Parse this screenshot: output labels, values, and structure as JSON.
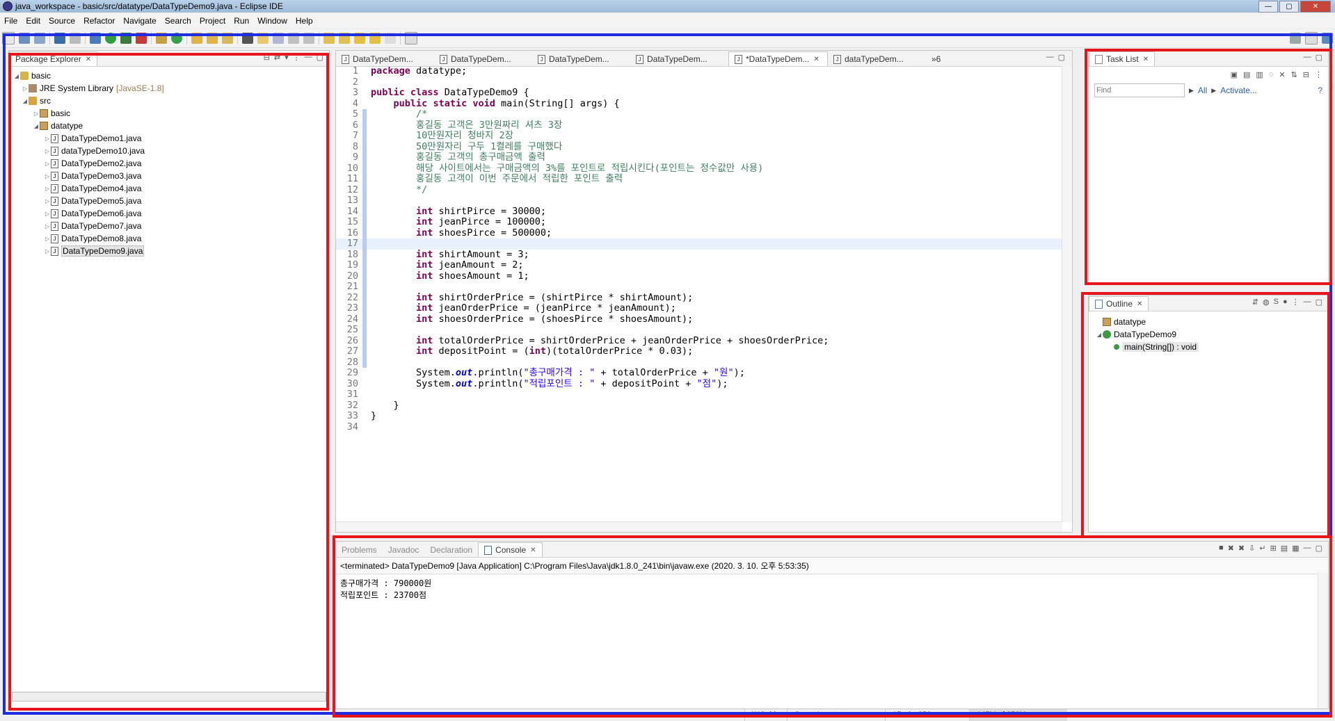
{
  "window": {
    "title": "java_workspace - basic/src/datatype/DataTypeDemo9.java - Eclipse IDE"
  },
  "menu": [
    "File",
    "Edit",
    "Source",
    "Refactor",
    "Navigate",
    "Search",
    "Project",
    "Run",
    "Window",
    "Help"
  ],
  "package_explorer": {
    "title": "Package Explorer",
    "project": "basic",
    "library": "JRE System Library",
    "library_version": "[JavaSE-1.8]",
    "src": "src",
    "packages": [
      "basic",
      "datatype"
    ],
    "files": [
      "DataTypeDemo1.java",
      "dataTypeDemo10.java",
      "DataTypeDemo2.java",
      "DataTypeDemo3.java",
      "DataTypeDemo4.java",
      "DataTypeDemo5.java",
      "DataTypeDemo6.java",
      "DataTypeDemo7.java",
      "DataTypeDemo8.java",
      "DataTypeDemo9.java"
    ]
  },
  "editor": {
    "tabs": [
      "DataTypeDem...",
      "DataTypeDem...",
      "DataTypeDem...",
      "DataTypeDem...",
      "*DataTypeDem...",
      "dataTypeDem..."
    ],
    "overflow": "»6",
    "lines": [
      "package datatype;",
      "",
      "public class DataTypeDemo9 {",
      "    public static void main(String[] args) {",
      "        /*",
      "        홍길동 고객은 3만원짜리 셔츠 3장",
      "        10만원자리 청바지 2장",
      "        50만원자리 구두 1켤레를 구매했다",
      "        홍길동 고객의 총구매금액 출력",
      "        해당 사이트에서는 구매금액의 3%를 포인트로 적립시킨다(포인트는 정수값만 사용)",
      "        홍길동 고객이 이번 주문에서 적립한 포인트 출력",
      "        */",
      "",
      "        int shirtPirce = 30000;",
      "        int jeanPirce = 100000;",
      "        int shoesPirce = 500000;",
      "",
      "        int shirtAmount = 3;",
      "        int jeanAmount = 2;",
      "        int shoesAmount = 1;",
      "",
      "        int shirtOrderPrice = (shirtPirce * shirtAmount);",
      "        int jeanOrderPrice = (jeanPirce * jeanAmount);",
      "        int shoesOrderPrice = (shoesPirce * shoesAmount);",
      "",
      "        int totalOrderPrice = shirtOrderPrice + jeanOrderPrice + shoesOrderPrice;",
      "        int depositPoint = (int)(totalOrderPrice * 0.03);",
      "",
      "        System.out.println(\"총구매가격 : \" + totalOrderPrice + \"원\");",
      "        System.out.println(\"적립포인트 : \" + depositPoint + \"점\");",
      "",
      "    }",
      "}",
      ""
    ]
  },
  "task_list": {
    "title": "Task List",
    "find_placeholder": "Find",
    "all": "All",
    "activate": "Activate..."
  },
  "outline": {
    "title": "Outline",
    "items": [
      "datatype",
      "DataTypeDemo9",
      "main(String[]) : void"
    ]
  },
  "console": {
    "tabs": [
      "Problems",
      "Javadoc",
      "Declaration",
      "Console"
    ],
    "header": "<terminated> DataTypeDemo9 [Java Application] C:\\Program Files\\Java\\jdk1.8.0_241\\bin\\javaw.exe (2020. 3. 10. 오후 5:53:35)",
    "output": [
      "총구매가격 : 790000원",
      "적립포인트 : 23700점"
    ]
  },
  "status": {
    "writable": "Writable",
    "insert": "Smart Insert",
    "position": "17 : 9 : 356",
    "memory": "145M of 256M"
  },
  "colors": {
    "red_box": "#e8141b",
    "blue_box": "#1f2de0"
  }
}
